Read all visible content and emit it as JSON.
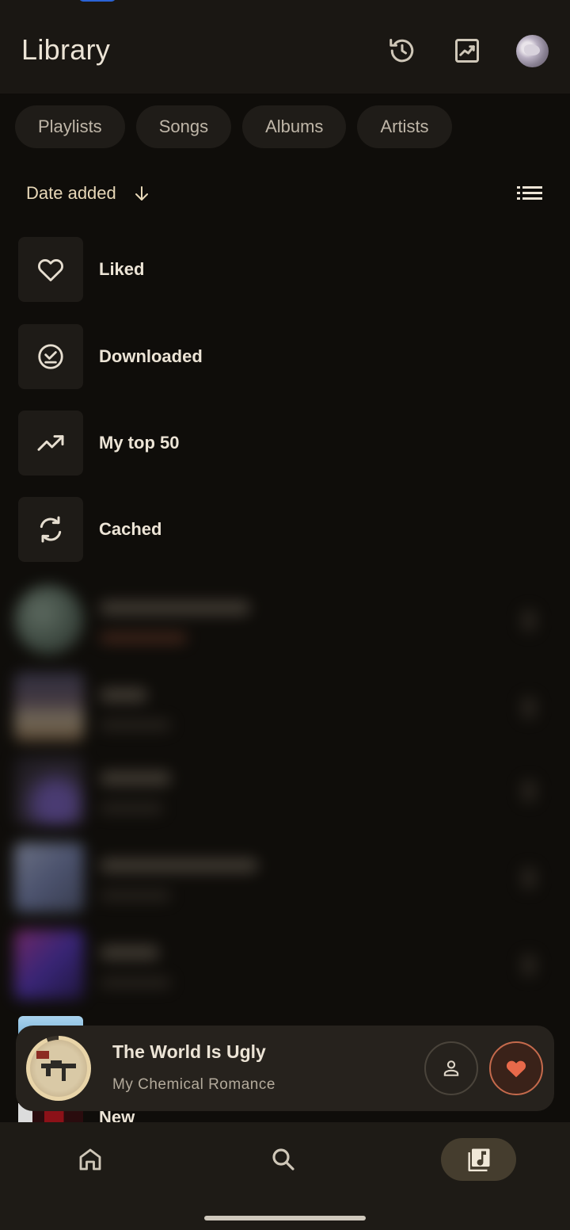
{
  "header": {
    "title": "Library",
    "icons": [
      "history-icon",
      "stats-trending-icon",
      "avatar"
    ]
  },
  "chips": [
    {
      "label": "Playlists"
    },
    {
      "label": "Songs"
    },
    {
      "label": "Albums"
    },
    {
      "label": "Artists"
    }
  ],
  "sort": {
    "label": "Date added",
    "direction_icon": "arrow-down-icon",
    "view_icon": "list-view-icon"
  },
  "library_items": [
    {
      "label": "Liked",
      "icon": "heart-outline-icon"
    },
    {
      "label": "Downloaded",
      "icon": "download-done-icon"
    },
    {
      "label": "My top 50",
      "icon": "trending-up-icon"
    },
    {
      "label": "Cached",
      "icon": "sync-icon"
    }
  ],
  "partially_hidden_item": {
    "label": "New"
  },
  "now_playing": {
    "title": "The World Is Ugly",
    "artist": "My Chemical Romance",
    "progress": 0.94,
    "liked": true
  },
  "bottom_nav": [
    {
      "name": "home",
      "icon": "home-icon",
      "active": false
    },
    {
      "name": "search",
      "icon": "search-icon",
      "active": false
    },
    {
      "name": "library",
      "icon": "library-music-icon",
      "active": true
    }
  ],
  "colors": {
    "background": "#0f0d0a",
    "surface": "#1a1713",
    "accent": "#e8d8b8",
    "like": "#e8694a"
  }
}
